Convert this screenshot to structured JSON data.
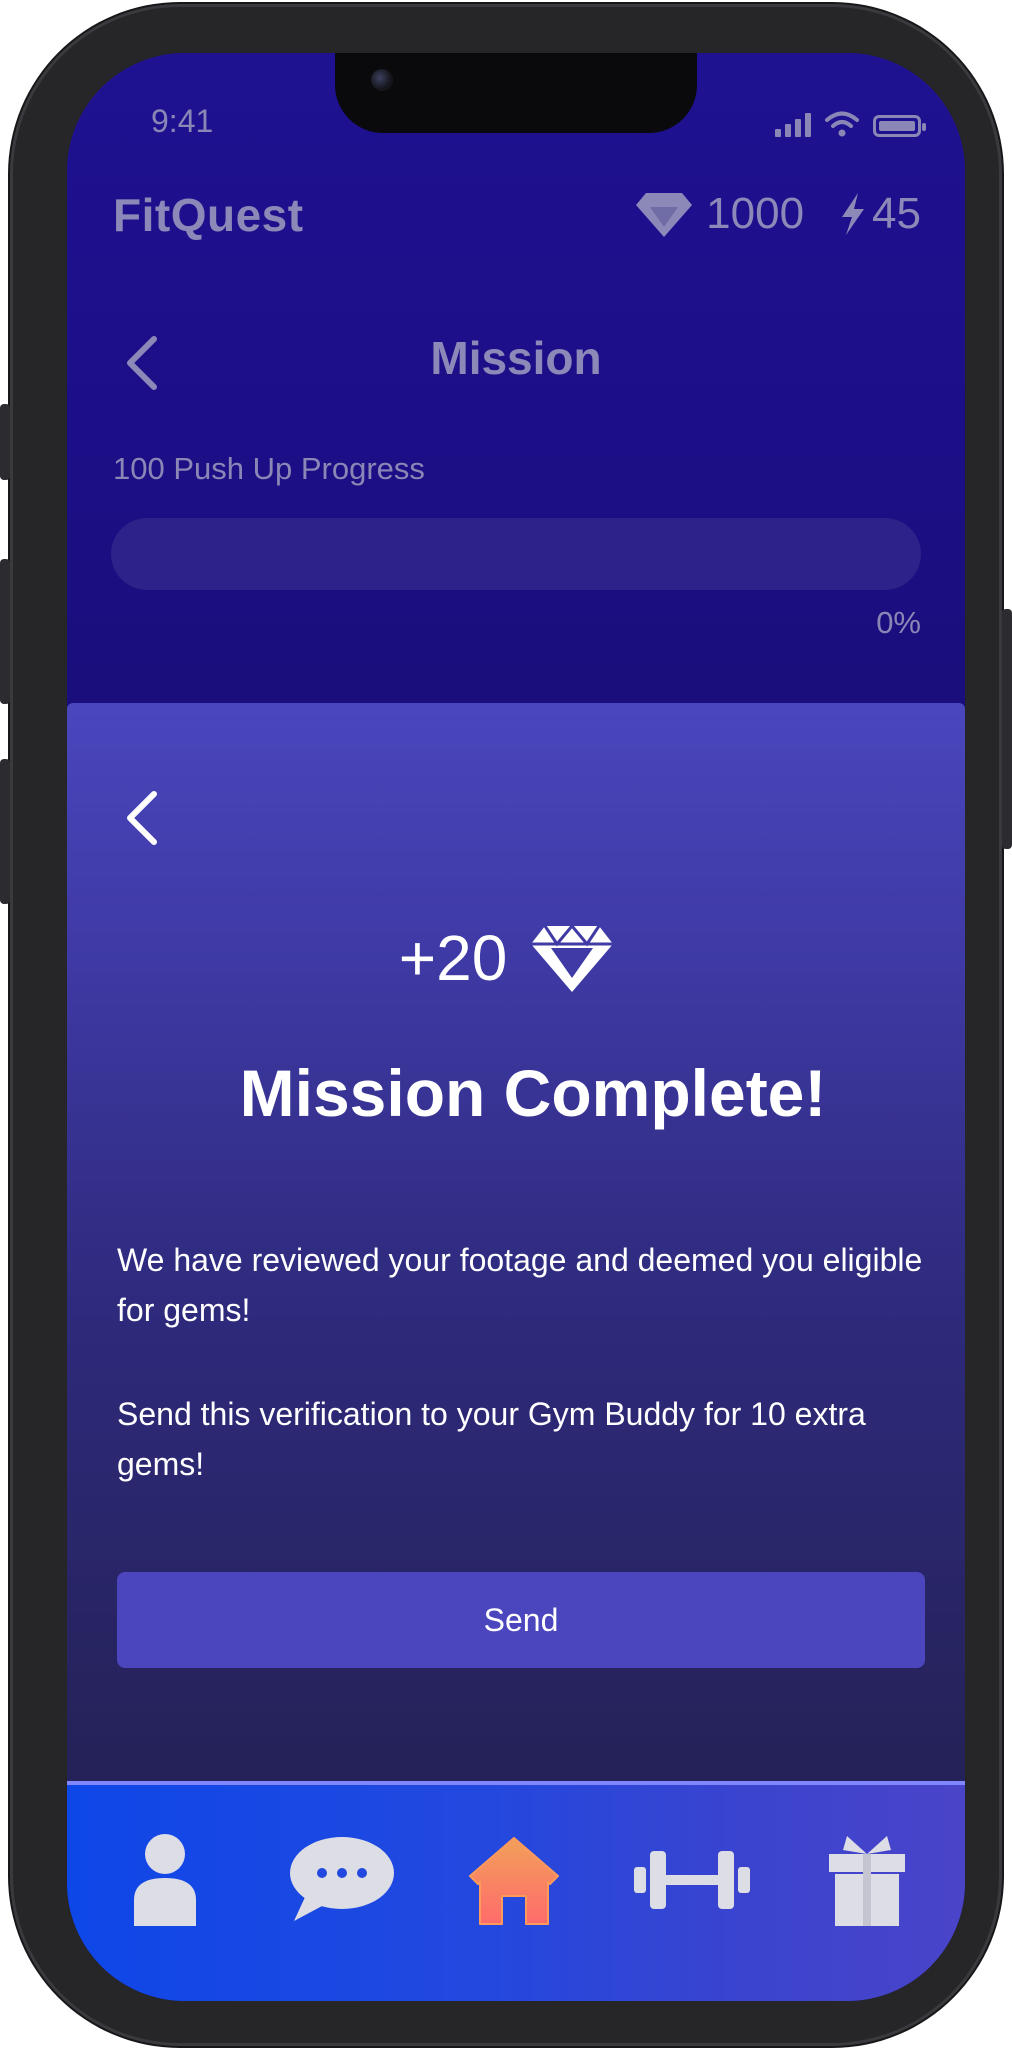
{
  "status_bar": {
    "time": "9:41",
    "icons": [
      "cellular-signal-icon",
      "wifi-icon",
      "battery-icon"
    ]
  },
  "app": {
    "title": "FitQuest",
    "gems": "1000",
    "energy": "45",
    "gems_icon": "diamond-icon",
    "energy_icon": "lightning-icon"
  },
  "header": {
    "title": "Mission",
    "back_icon": "chevron-left-icon"
  },
  "progress": {
    "label": "100 Push Up Progress",
    "value": 0,
    "percent_text": "0%"
  },
  "modal": {
    "back_icon": "chevron-left-icon",
    "reward_text": "+20",
    "reward_icon": "diamond-icon",
    "title": "Mission Complete!",
    "message1": "We have reviewed your footage and deemed you eligible for gems!",
    "message2": "Send this verification to your Gym Buddy for 10 extra gems!",
    "send_label": "Send"
  },
  "nav": {
    "items": [
      {
        "icon": "profile-icon",
        "active": false
      },
      {
        "icon": "chat-icon",
        "active": false
      },
      {
        "icon": "home-icon",
        "active": true
      },
      {
        "icon": "dumbbell-icon",
        "active": false
      },
      {
        "icon": "gift-icon",
        "active": false
      }
    ]
  },
  "colors": {
    "top_background": "#1c0e86",
    "modal_top": "#4a46bd",
    "modal_bottom": "#242156",
    "button": "#4b46bd",
    "nav_left": "#0e47e8",
    "nav_right": "#4a44c8",
    "home_active_top": "#f2a05a",
    "home_active_bottom": "#ff6b6b",
    "icon_inactive": "#dddde6",
    "muted_text": "#8c89b8"
  }
}
